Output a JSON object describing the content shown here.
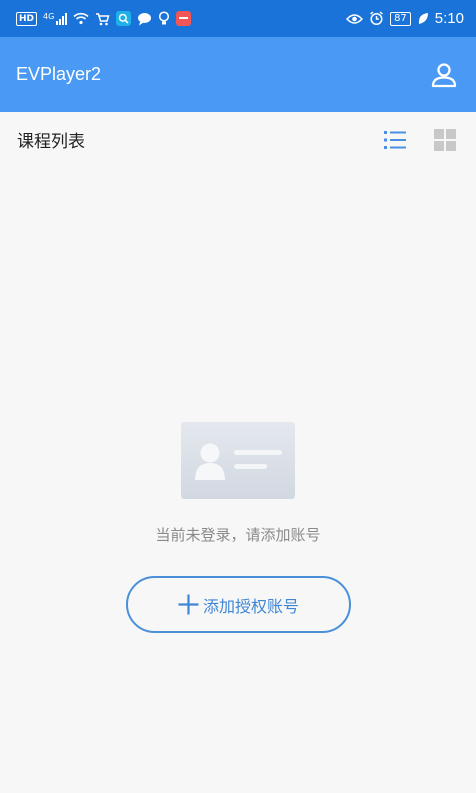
{
  "status_bar": {
    "left_icons": [
      "hd-icon",
      "signal-icon",
      "wifi-icon",
      "shopping-cart-icon",
      "search-app-icon",
      "chat-icon",
      "bulb-icon",
      "red-app-icon"
    ],
    "hd_text": "HD",
    "network_text": "4G",
    "battery": "87",
    "time": "5:10",
    "colors": {
      "background": "#1a73d9"
    }
  },
  "app_bar": {
    "title": "EVPlayer2",
    "profile_icon": "person-icon",
    "colors": {
      "background": "#4a9af5"
    }
  },
  "section": {
    "title": "课程列表",
    "list_view_icon": "list-view-icon",
    "grid_view_icon": "grid-view-icon",
    "active_view": "list",
    "colors": {
      "active": "#4a90e2",
      "inactive": "#c8c8c8"
    }
  },
  "empty_state": {
    "illustration_icon": "id-card-icon",
    "message": "当前未登录，请添加账号",
    "button_label": "添加授权账号",
    "button_icon": "plus-icon",
    "colors": {
      "accent": "#3f86d6",
      "message": "#8a8a8a"
    }
  }
}
